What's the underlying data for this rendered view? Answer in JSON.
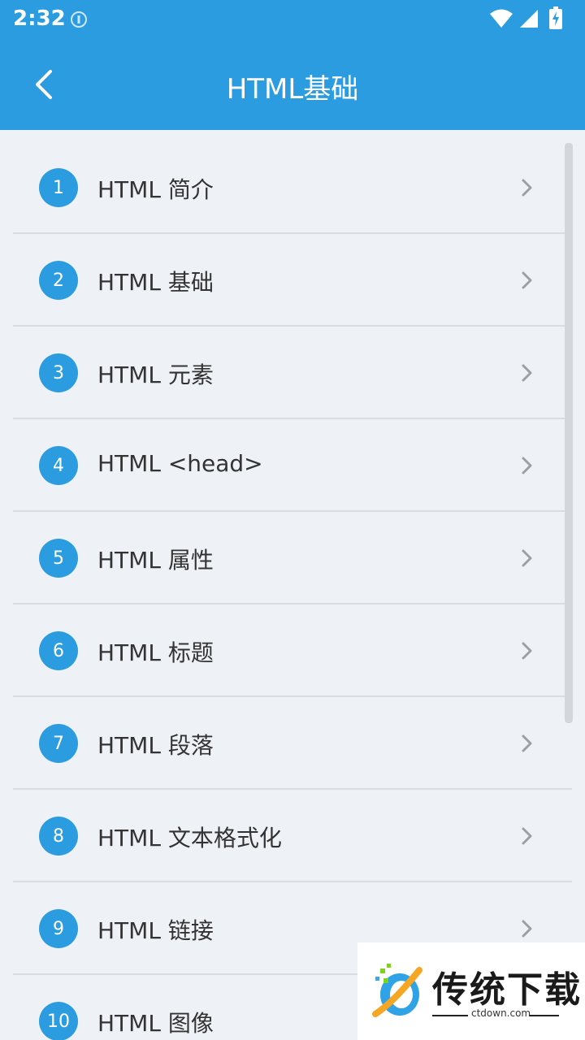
{
  "status_bar": {
    "time": "2:32",
    "icons": [
      "info-icon",
      "wifi-icon",
      "signal-icon",
      "battery-charging-icon"
    ]
  },
  "app_bar": {
    "title": "HTML基础",
    "back_icon": "chevron-left-icon",
    "color": "#2b9ce0"
  },
  "list": {
    "items": [
      {
        "num": "1",
        "label": "HTML 简介"
      },
      {
        "num": "2",
        "label": "HTML 基础"
      },
      {
        "num": "3",
        "label": "HTML 元素"
      },
      {
        "num": "4",
        "label": "HTML <head>"
      },
      {
        "num": "5",
        "label": "HTML 属性"
      },
      {
        "num": "6",
        "label": "HTML 标题"
      },
      {
        "num": "7",
        "label": "HTML 段落"
      },
      {
        "num": "8",
        "label": "HTML 文本格式化"
      },
      {
        "num": "9",
        "label": "HTML 链接"
      },
      {
        "num": "10",
        "label": "HTML 图像"
      }
    ],
    "chevron_icon": "chevron-right-icon"
  },
  "watermark": {
    "text": "传统下载",
    "subtext": "ctdown.com"
  }
}
